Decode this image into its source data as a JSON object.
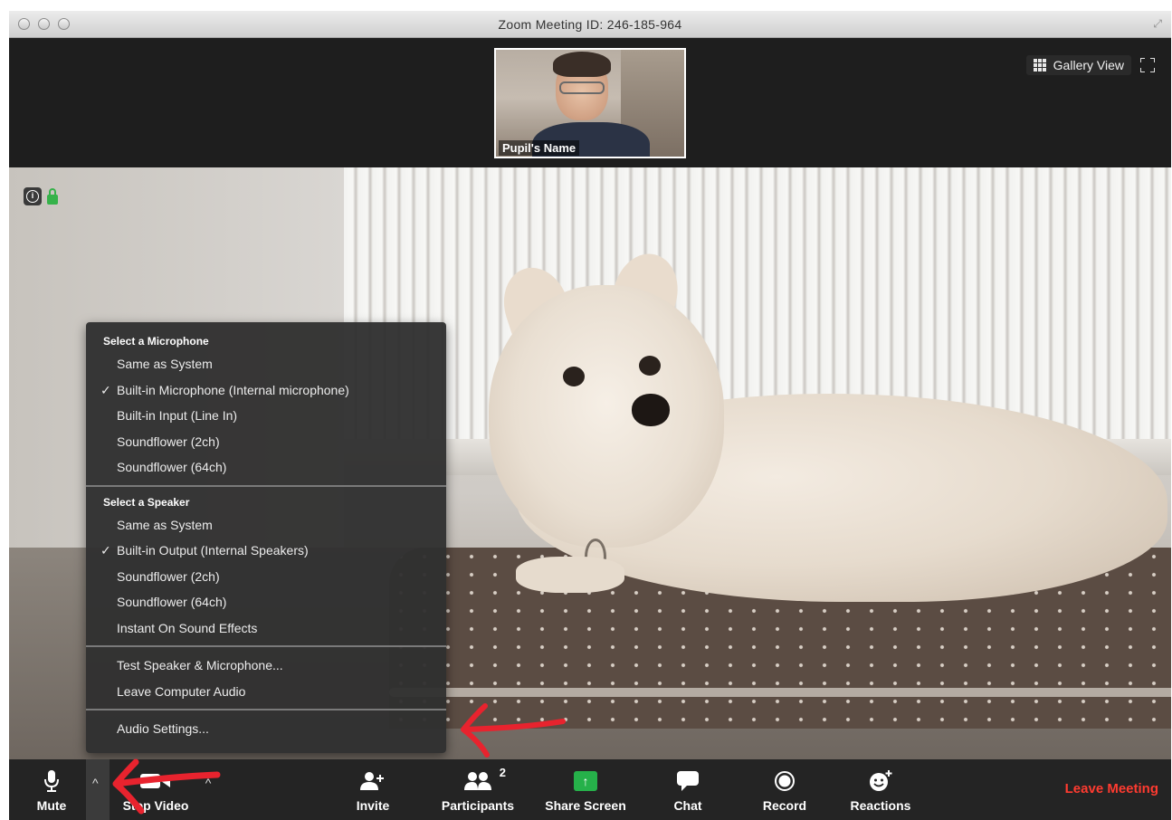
{
  "window": {
    "title": "Zoom Meeting ID: 246-185-964"
  },
  "thumbnail": {
    "name": "Pupil's Name"
  },
  "top_controls": {
    "gallery_view_label": "Gallery View"
  },
  "audio_menu": {
    "microphone_header": "Select a Microphone",
    "microphones": [
      {
        "label": "Same as System",
        "checked": false
      },
      {
        "label": "Built-in Microphone (Internal microphone)",
        "checked": true
      },
      {
        "label": "Built-in Input (Line In)",
        "checked": false
      },
      {
        "label": "Soundflower (2ch)",
        "checked": false
      },
      {
        "label": "Soundflower (64ch)",
        "checked": false
      }
    ],
    "speaker_header": "Select a Speaker",
    "speakers": [
      {
        "label": "Same as System",
        "checked": false
      },
      {
        "label": "Built-in Output (Internal Speakers)",
        "checked": true
      },
      {
        "label": "Soundflower (2ch)",
        "checked": false
      },
      {
        "label": "Soundflower (64ch)",
        "checked": false
      },
      {
        "label": "Instant On Sound Effects",
        "checked": false
      }
    ],
    "test_label": "Test Speaker & Microphone...",
    "leave_audio_label": "Leave Computer Audio",
    "settings_label": "Audio Settings...",
    "check_glyph": "✓"
  },
  "toolbar": {
    "mute_label": "Mute",
    "stop_video_label": "Stop Video",
    "invite_label": "Invite",
    "participants_label": "Participants",
    "participants_count": "2",
    "share_screen_label": "Share Screen",
    "chat_label": "Chat",
    "record_label": "Record",
    "reactions_label": "Reactions",
    "leave_label": "Leave Meeting",
    "caret_glyph": "^"
  },
  "colors": {
    "leave_red": "#ff3b30",
    "share_green": "#26b14a",
    "lock_green": "#36b24a",
    "annotation_red": "#e8232e"
  }
}
